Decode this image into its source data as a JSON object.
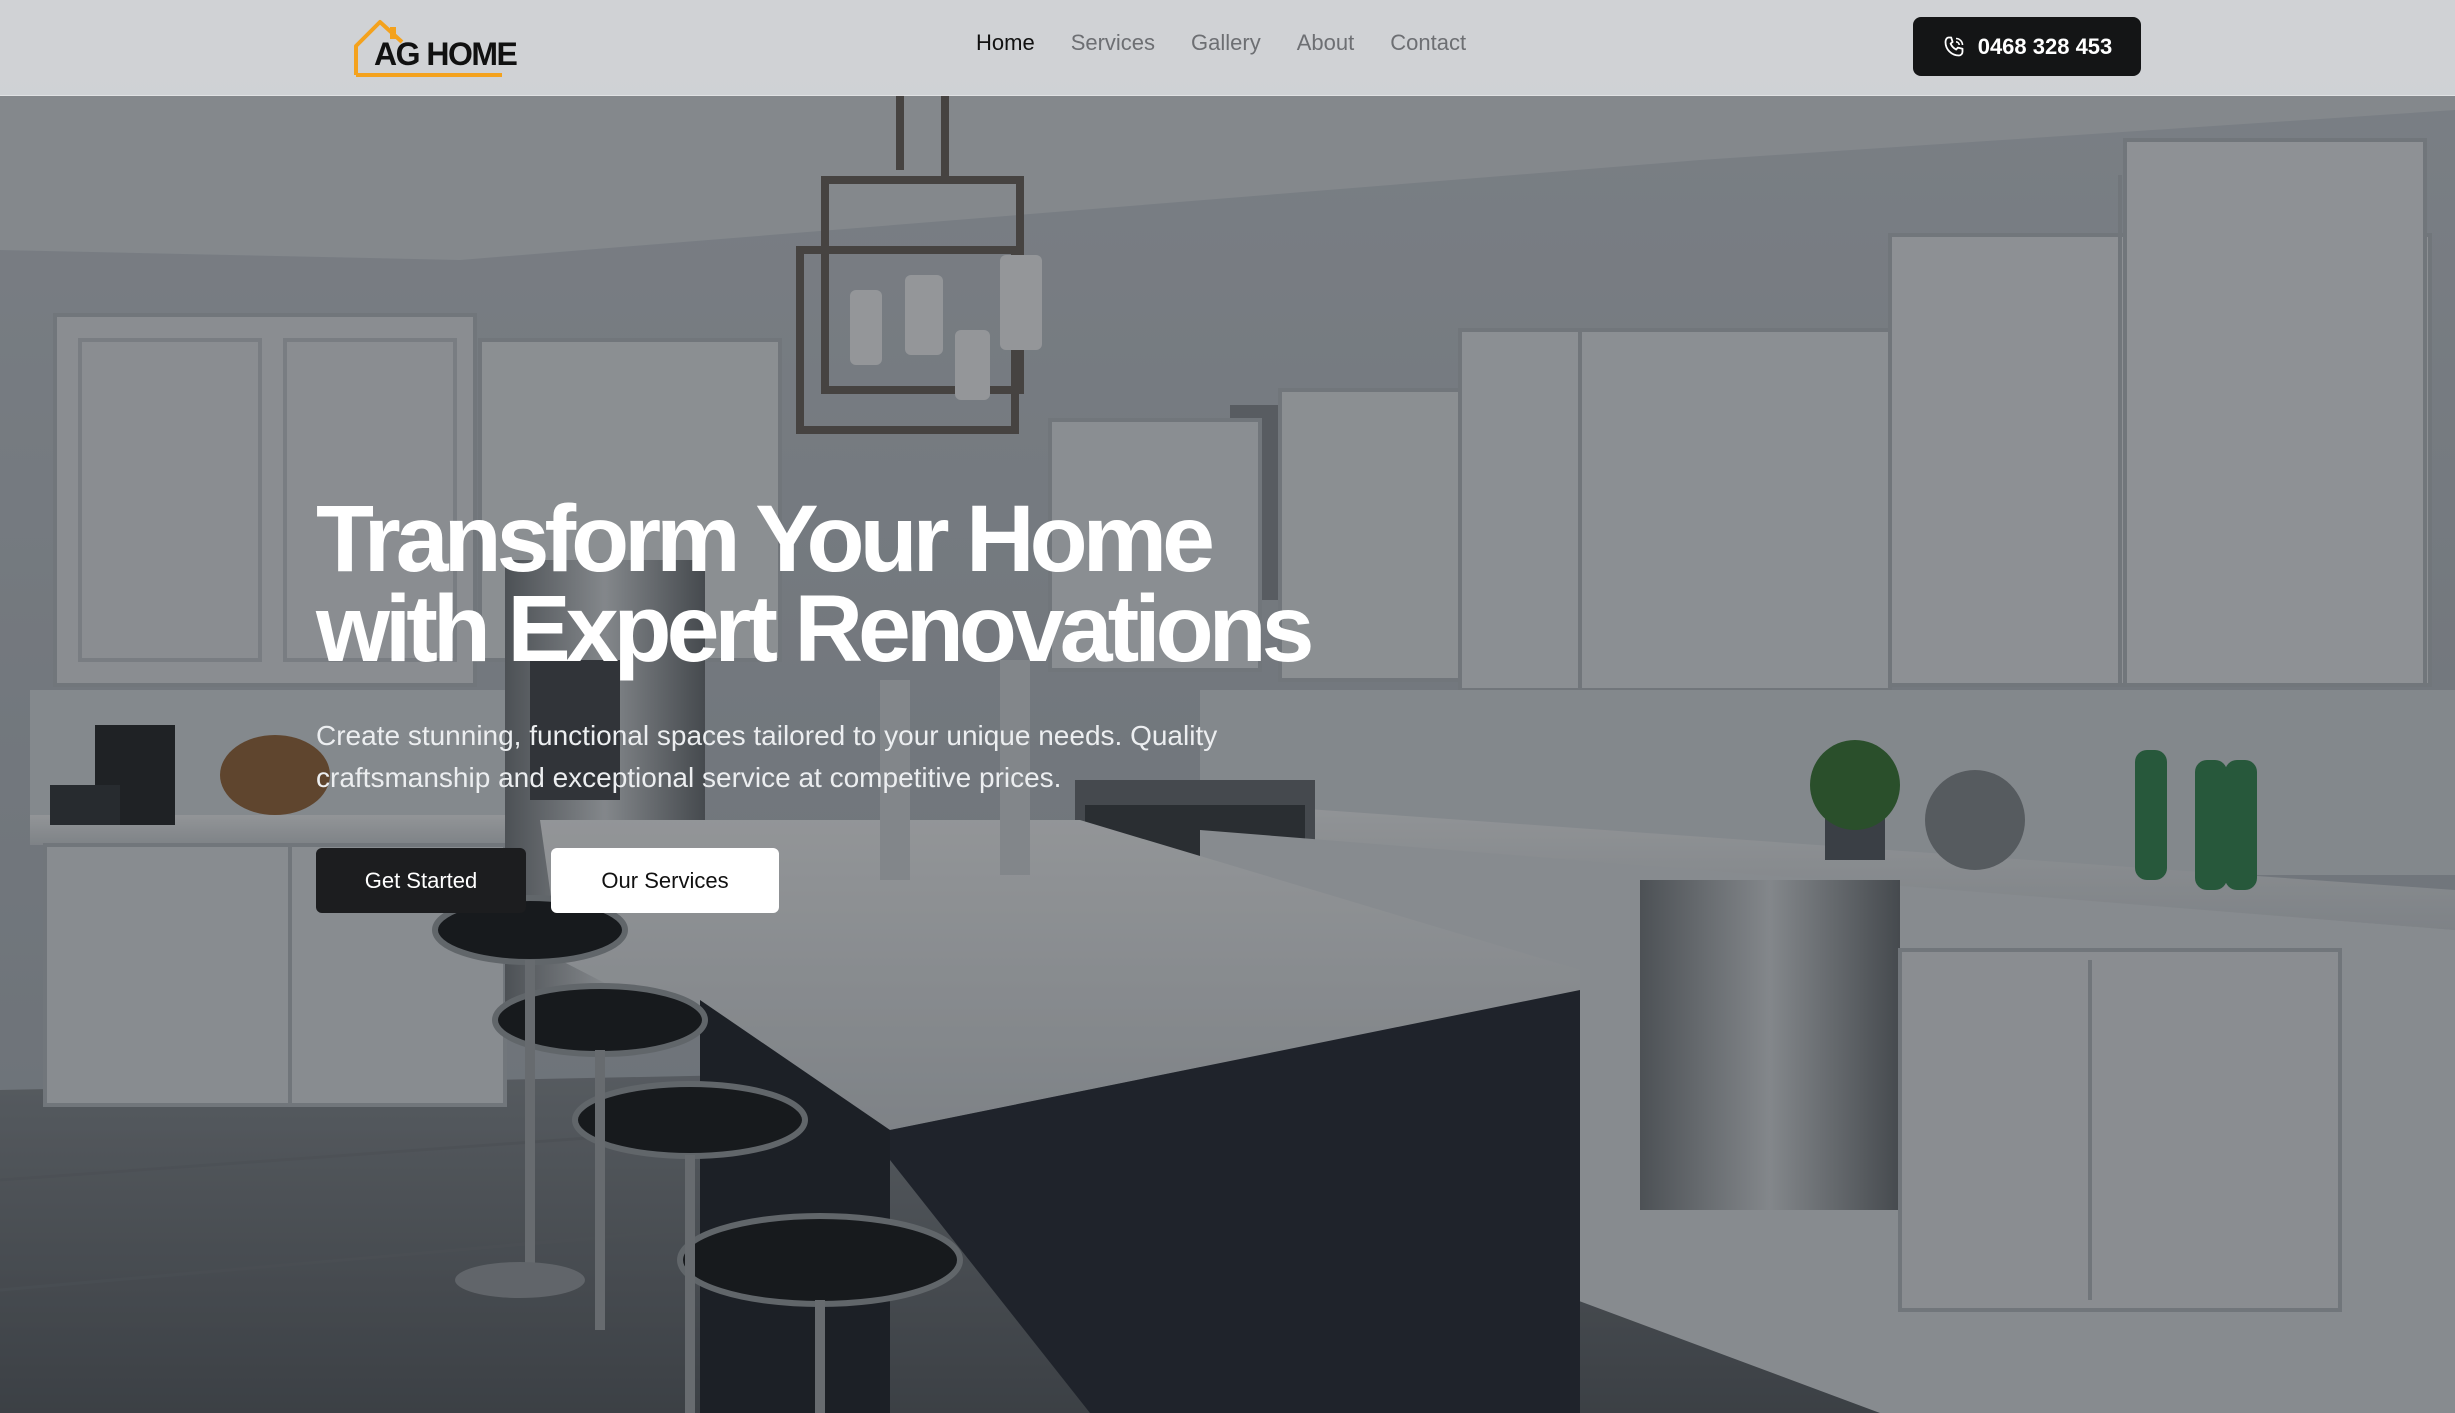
{
  "brand": {
    "logo_text": "AG HOME",
    "accent_color": "#f4a21d"
  },
  "nav": {
    "links": [
      "Home",
      "Services",
      "Gallery",
      "About",
      "Contact"
    ],
    "active": "Home"
  },
  "phone": {
    "icon": "phone-icon",
    "number": "0468 328 453"
  },
  "hero": {
    "headline_line1": "Transform Your Home",
    "headline_line2": "with Expert Renovations",
    "subtext": "Create stunning, functional spaces tailored to your unique needs. Quality craftsmanship and exceptional service at competitive prices.",
    "primary_cta": "Get Started",
    "secondary_cta": "Our Services"
  },
  "colors": {
    "dark_button": "#1c1d1f",
    "text_on_dark": "#ffffff"
  }
}
